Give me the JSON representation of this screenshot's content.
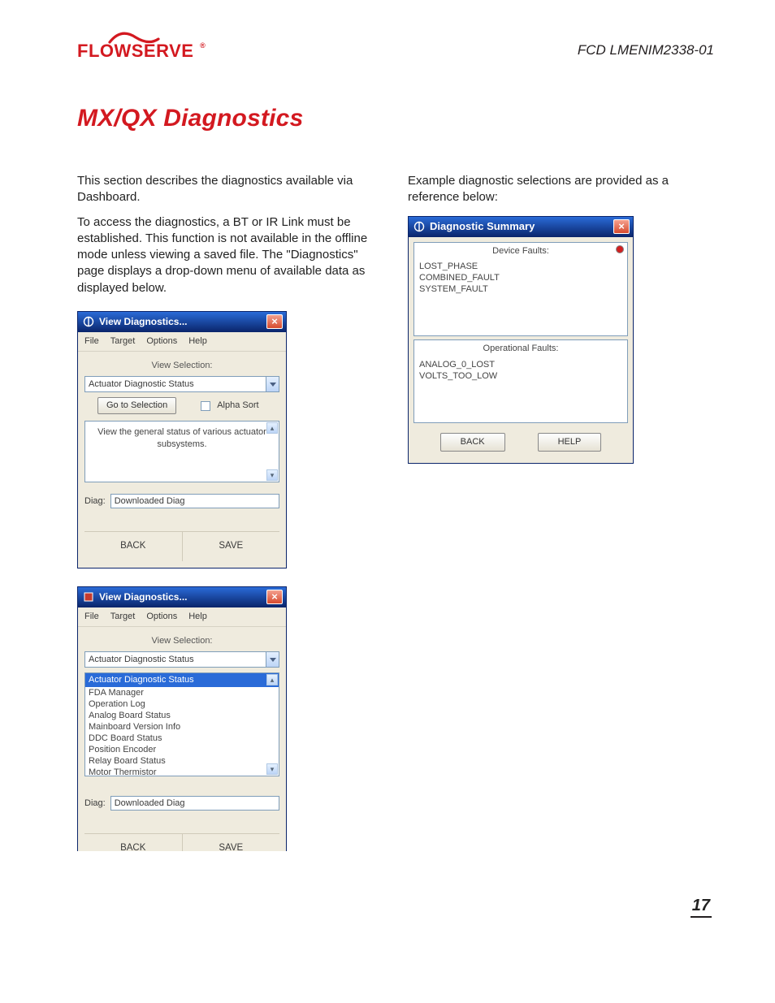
{
  "header": {
    "logo_text": "FLOWSERVE",
    "doc_id": "FCD LMENIM2338-01"
  },
  "title": "MX/QX Diagnostics",
  "left": {
    "p1": "This section describes the diagnostics available via Dashboard.",
    "p2": "To access the diagnostics, a BT or IR Link must be established. This function is not available in the offline mode unless viewing a saved file. The \"Diagnostics\" page displays a drop-down menu of available data as displayed below."
  },
  "right": {
    "p1": "Example diagnostic selections are provided as a reference below:"
  },
  "win1": {
    "title": "View Diagnostics...",
    "menu": {
      "file": "File",
      "target": "Target",
      "options": "Options",
      "help": "Help"
    },
    "view_sel_label": "View Selection:",
    "combo_value": "Actuator Diagnostic Status",
    "goto_label": "Go to Selection",
    "alpha_label": "Alpha Sort",
    "desc": "View the general status of various actuator subsystems.",
    "diag_label": "Diag:",
    "diag_value": "Downloaded Diag",
    "back_label": "BACK",
    "save_label": "SAVE"
  },
  "win2": {
    "title": "View Diagnostics...",
    "menu": {
      "file": "File",
      "target": "Target",
      "options": "Options",
      "help": "Help"
    },
    "view_sel_label": "View Selection:",
    "combo_value": "Actuator Diagnostic Status",
    "list": {
      "selected": "Actuator Diagnostic Status",
      "items": [
        "FDA Manager",
        "Operation Log",
        "Analog Board Status",
        "Mainboard Version Info",
        "DDC Board Status",
        "Position Encoder",
        "Relay Board Status",
        "Motor Thermistor"
      ]
    },
    "diag_label": "Diag:",
    "diag_value": "Downloaded Diag",
    "back_label": "BACK",
    "save_label": "SAVE"
  },
  "win_sum": {
    "title": "Diagnostic Summary",
    "device_faults_label": "Device Faults:",
    "device_faults": [
      "LOST_PHASE",
      "COMBINED_FAULT",
      "SYSTEM_FAULT"
    ],
    "device_led_color": "#d02020",
    "op_faults_label": "Operational Faults:",
    "op_faults": [
      "ANALOG_0_LOST",
      "VOLTS_TOO_LOW"
    ],
    "back_label": "BACK",
    "help_label": "HELP"
  },
  "page_number": "17"
}
